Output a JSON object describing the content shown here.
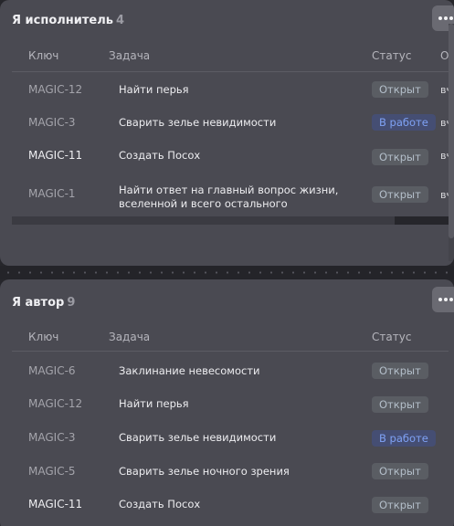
{
  "panel_executor": {
    "title": "Я исполнитель",
    "count": "4",
    "columns": {
      "key": "Ключ",
      "task": "Задача",
      "status": "Статус",
      "extra": "О"
    },
    "rows": [
      {
        "key": "MAGIC-12",
        "task": "Найти перья",
        "status": "Открыт",
        "extra": "вч"
      },
      {
        "key": "MAGIC-3",
        "task": "Сварить зелье невидимости",
        "status": "В работе",
        "extra": "вч"
      },
      {
        "key": "MAGIC-11",
        "task": "Создать Посох",
        "status": "Открыт",
        "extra": "вч"
      },
      {
        "key": "MAGIC-1",
        "task_line1": "Найти ответ на главный вопрос жизни,",
        "task_line2": "вселенной и всего остального",
        "status": "Открыт",
        "extra": "вч"
      }
    ]
  },
  "panel_author": {
    "title": "Я автор",
    "count": "9",
    "columns": {
      "key": "Ключ",
      "task": "Задача",
      "status": "Статус"
    },
    "rows": [
      {
        "key": "MAGIC-6",
        "task": "Заклинание невесомости",
        "status": "Открыт"
      },
      {
        "key": "MAGIC-12",
        "task": "Найти перья",
        "status": "Открыт"
      },
      {
        "key": "MAGIC-3",
        "task": "Сварить зелье невидимости",
        "status": "В работе"
      },
      {
        "key": "MAGIC-5",
        "task": "Сварить зелье ночного зрения",
        "status": "Открыт"
      },
      {
        "key": "MAGIC-11",
        "task": "Создать Посох",
        "status": "Открыт"
      }
    ]
  },
  "colors": {
    "panel_bg": "#4a4a52",
    "page_bg": "#26262b",
    "badge_open_bg": "#5a5d63",
    "badge_open_text": "#b3bec9",
    "badge_inwork_bg": "#454e73",
    "badge_inwork_text": "#7fa2f5"
  },
  "icons": {
    "more_menu": "more-horizontal-icon"
  }
}
